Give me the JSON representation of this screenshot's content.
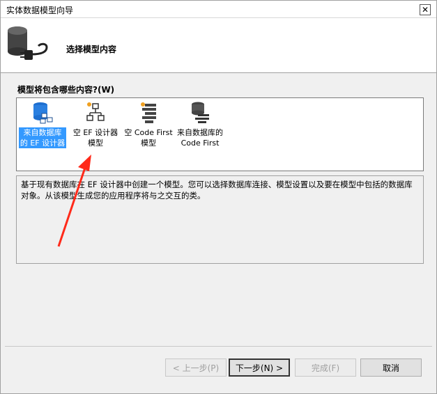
{
  "window": {
    "title": "实体数据模型向导",
    "close_label": "✕"
  },
  "header": {
    "title": "选择模型内容"
  },
  "prompt": {
    "label": "模型将包含哪些内容?(W)"
  },
  "options": [
    {
      "line1": "来自数据库",
      "line2": "的 EF 设计器",
      "selected": true
    },
    {
      "line1": "空 EF 设计器",
      "line2": "模型",
      "selected": false
    },
    {
      "line1": "空 Code First",
      "line2": "模型",
      "selected": false
    },
    {
      "line1": "来自数据库的",
      "line2": "Code First",
      "selected": false
    }
  ],
  "description": {
    "text": "基于现有数据库在 EF 设计器中创建一个模型。您可以选择数据库连接、模型设置以及要在模型中包括的数据库对象。从该模型生成您的应用程序将与之交互的类。"
  },
  "buttons": {
    "prev": "< 上一步(P)",
    "next": "下一步(N) >",
    "finish": "完成(F)",
    "cancel": "取消"
  },
  "colors": {
    "selection": "#3399ff",
    "annotation_arrow": "#ff2a1a"
  },
  "icons": {
    "header": "database-plug-icon",
    "option_icons": [
      "database-model-icon",
      "empty-model-icon",
      "code-first-icon",
      "code-first-database-icon"
    ]
  }
}
